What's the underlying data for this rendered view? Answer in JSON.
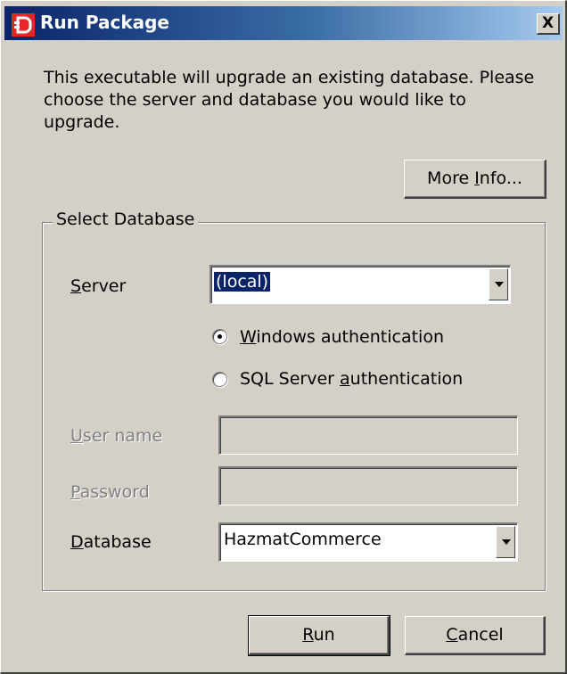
{
  "window": {
    "title": "Run Package",
    "close_glyph": "X",
    "app_icon": "database-package-icon",
    "accent_color": "#0a246a"
  },
  "description": "This executable will upgrade an existing database. Please choose the server and database you would like to upgrade.",
  "more_info_button": {
    "prefix": "More ",
    "accel": "I",
    "suffix": "nfo..."
  },
  "group": {
    "title": "Select Database",
    "server": {
      "label_accel": "S",
      "label_rest": "erver",
      "value": "(local)"
    },
    "auth_windows": {
      "label_accel": "W",
      "label_rest": "indows authentication",
      "selected": true
    },
    "auth_sql": {
      "label_prefix": "SQL Server ",
      "label_accel": "a",
      "label_rest": "uthentication",
      "selected": false
    },
    "username": {
      "label_accel": "U",
      "label_rest": "ser name",
      "value": ""
    },
    "password": {
      "label_accel": "P",
      "label_rest": "assword",
      "value": ""
    },
    "database": {
      "label_accel": "D",
      "label_rest": "atabase",
      "value": "HazmatCommerce"
    }
  },
  "buttons": {
    "run": {
      "accel": "R",
      "rest": "un"
    },
    "cancel": {
      "accel": "C",
      "rest": "ancel"
    }
  }
}
